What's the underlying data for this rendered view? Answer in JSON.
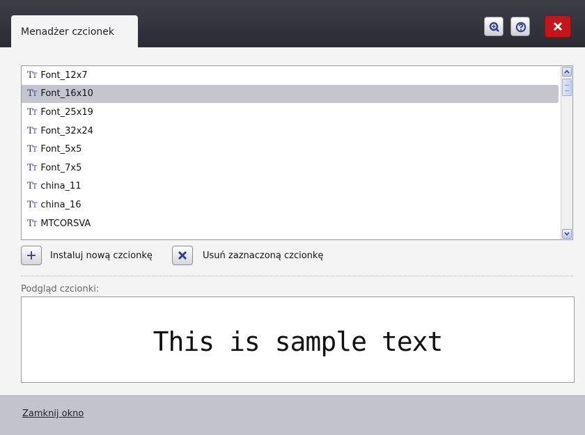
{
  "window": {
    "tab_title": "Menadżer czcionek",
    "buttons": [
      "zoom-button",
      "help-button",
      "close-button"
    ]
  },
  "font_list": {
    "selected_index": 1,
    "items": [
      {
        "icon": "tt-font-icon",
        "label": "Font_12x7"
      },
      {
        "icon": "tt-font-icon",
        "label": "Font_16x10"
      },
      {
        "icon": "tt-font-icon",
        "label": "Font_25x19"
      },
      {
        "icon": "tt-font-icon",
        "label": "Font_32x24"
      },
      {
        "icon": "tt-font-icon",
        "label": "Font_5x5"
      },
      {
        "icon": "tt-font-icon",
        "label": "Font_7x5"
      },
      {
        "icon": "tt-font-icon",
        "label": "china_11"
      },
      {
        "icon": "tt-font-icon",
        "label": "china_16"
      },
      {
        "icon": "tt-font-icon",
        "label": "MTCORSVA"
      }
    ]
  },
  "actions": {
    "install_label": "Instaluj nową czcionkę",
    "remove_label": "Usuń zaznaczoną czcionkę"
  },
  "preview": {
    "label": "Podgląd czcionki:",
    "sample_text": "This is sample text"
  },
  "footer": {
    "close_link": "Zamknij okno"
  },
  "colors": {
    "titlebar": "#33343c",
    "close_button": "#c4151c",
    "selected_row": "#c5c6cd",
    "footer": "#c3c4cb"
  }
}
